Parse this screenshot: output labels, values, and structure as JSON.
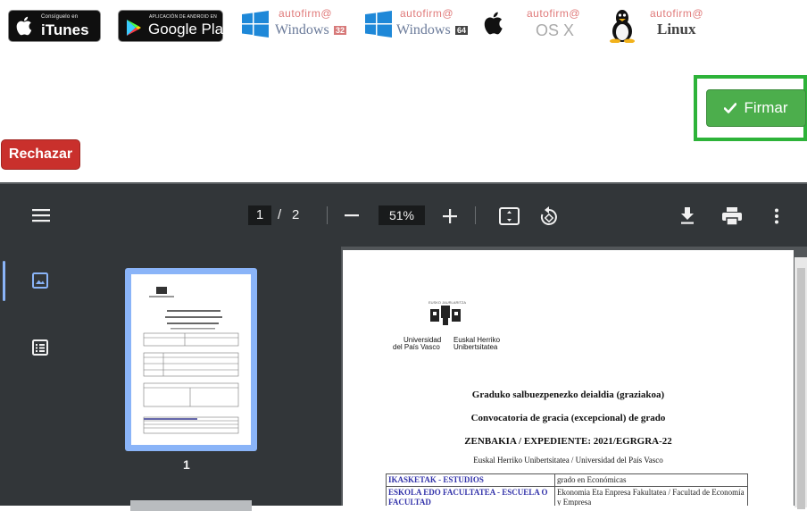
{
  "badges": {
    "itunes": {
      "small": "Consíguelo en",
      "big": "iTunes"
    },
    "google_play": {
      "small": "APLICACIÓN DE ANDROID EN",
      "big": "Google Play"
    },
    "autofirma_brand": "autofirm@",
    "win32_os": "Windows",
    "win32_tag": "32",
    "win64_os": "Windows",
    "win64_tag": "64",
    "osx_os": "OS X",
    "linux_os": "Linux"
  },
  "actions": {
    "firmar_label": "Firmar",
    "rechazar_label": "Rechazar"
  },
  "viewer": {
    "current_page": "1",
    "page_separator": "/",
    "total_pages": "2",
    "zoom": "51%",
    "thumbnail_page_number": "1"
  },
  "document": {
    "logo_small": "EUSKO JAURLARITZA",
    "logo_left_1": "Universidad",
    "logo_left_2": "del País Vasco",
    "logo_right_1": "Euskal Herriko",
    "logo_right_2": "Unibertsitatea",
    "title_eu": "Graduko salbuezpenezko deialdia (graziakoa)",
    "title_es": "Convocatoria de gracia (excepcional) de grado",
    "expediente": "ZENBAKIA / EXPEDIENTE: 2021/EGRGRA-22",
    "university": "Euskal Herriko Unibertsitatea / Universidad del País Vasco",
    "table": [
      {
        "key": "IKASKETAK - ESTUDIOS",
        "value": "grado en Económicas"
      },
      {
        "key": "ESKOLA EDO FACULTATEA - ESCUELA O FACULTAD",
        "value": "Ekonomia Eta Enpresa Fakultatea / Facultad de Economía y Empresa"
      }
    ]
  },
  "colors": {
    "firmar_green": "#4cae4c",
    "frame_green": "#2db339",
    "rechazar_red": "#c9302c",
    "toolbar_bg": "#323639",
    "viewer_bg": "#525659",
    "thumb_accent": "#8ab4f8"
  },
  "icons": [
    "apple-icon",
    "play-store-icon",
    "windows-icon",
    "linux-tux-icon",
    "check-icon",
    "menu-icon",
    "zoom-out-icon",
    "zoom-in-icon",
    "fit-page-icon",
    "rotate-icon",
    "download-icon",
    "print-icon",
    "more-vert-icon",
    "thumbnails-icon",
    "outline-icon"
  ]
}
